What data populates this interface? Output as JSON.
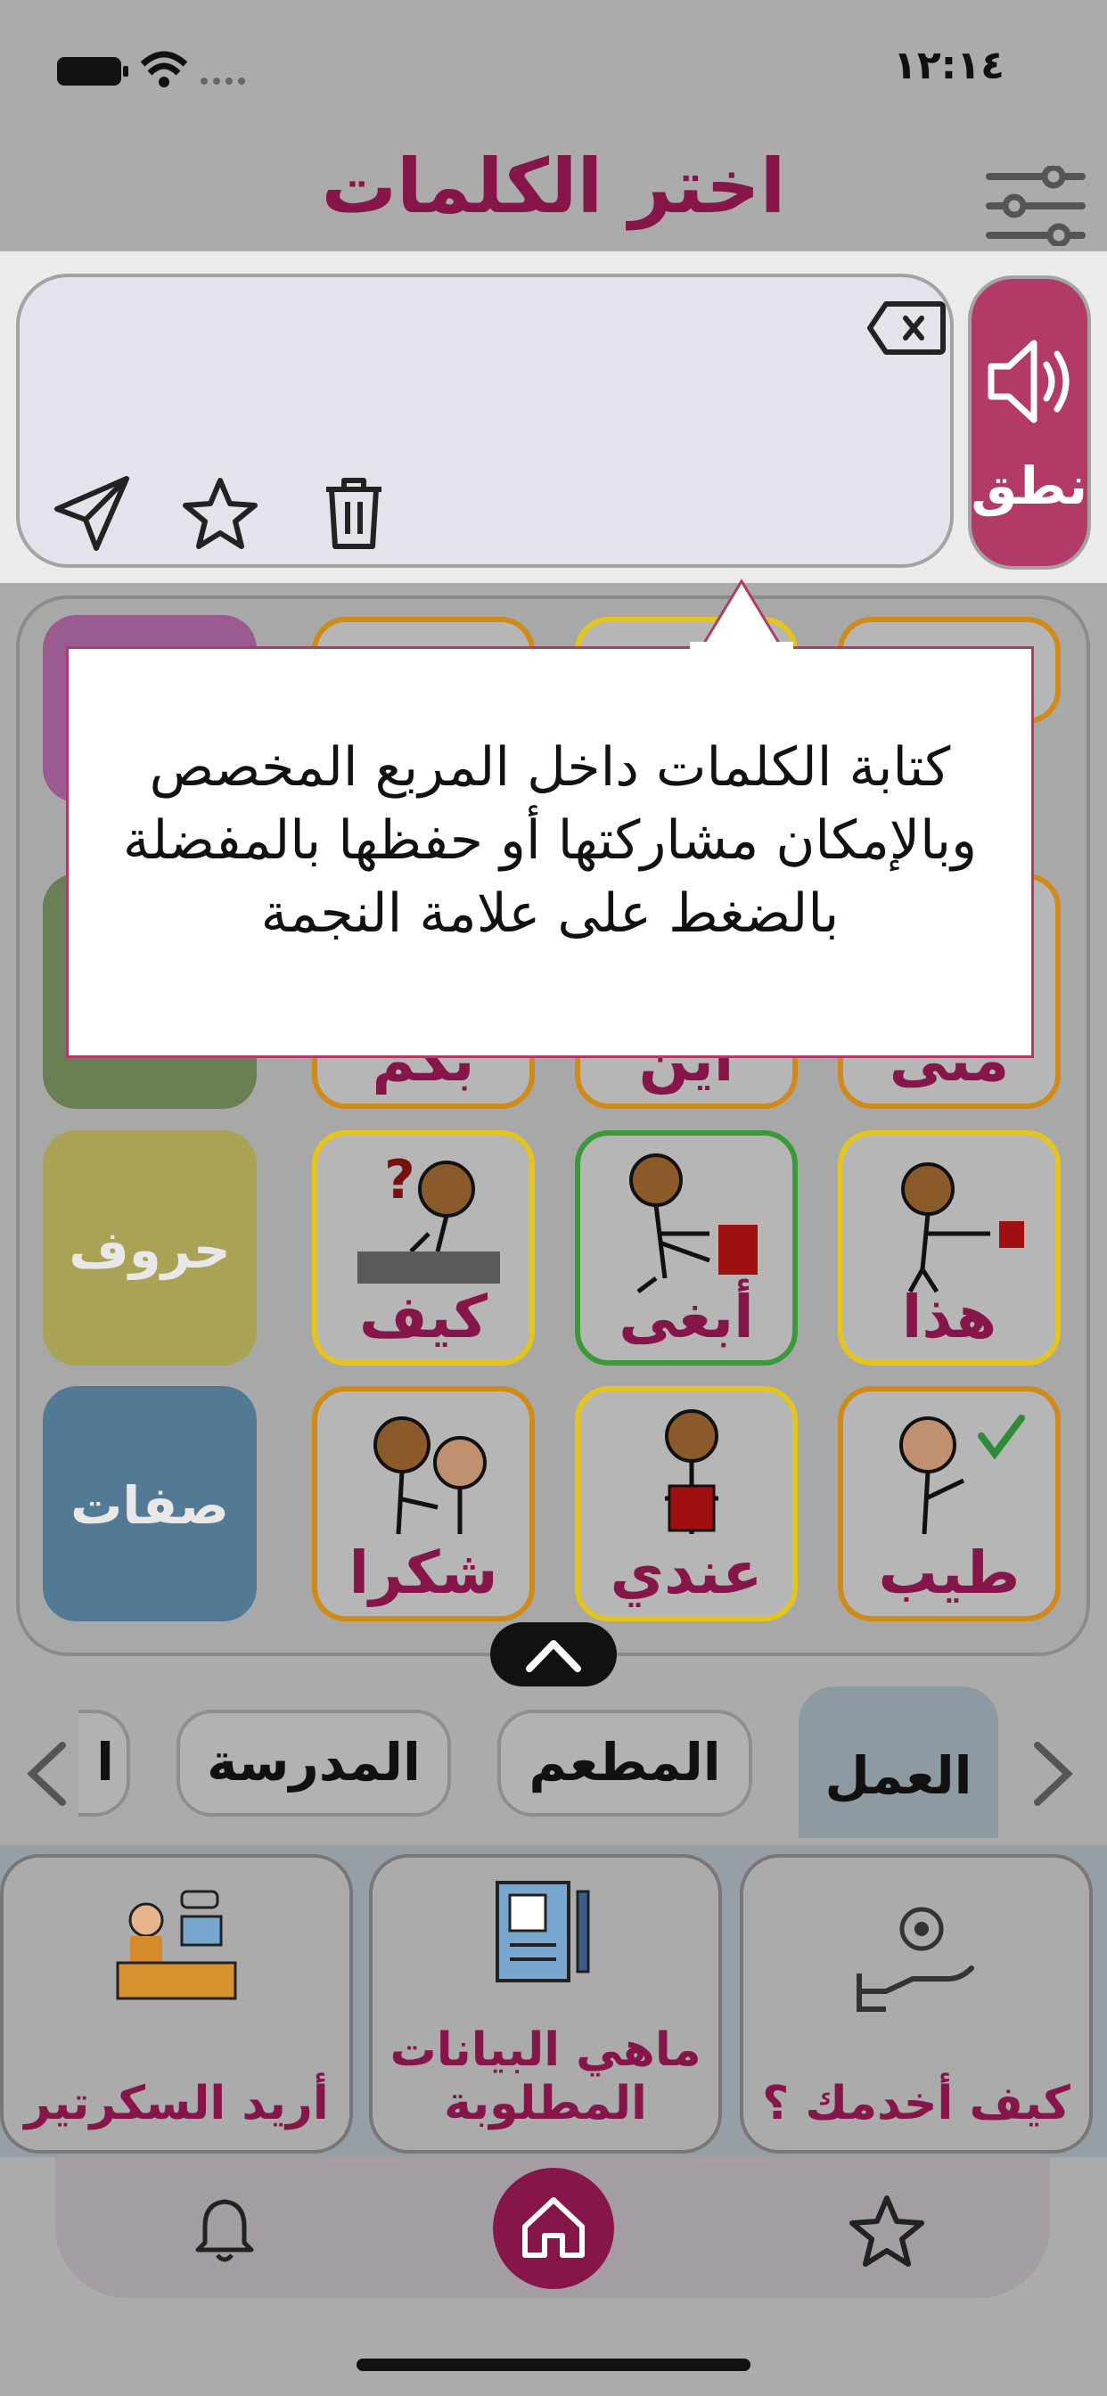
{
  "status_bar": {
    "time": "١٢:١٤"
  },
  "header": {
    "title": "اختر الكلمات"
  },
  "compose": {
    "speak_label": "نطق"
  },
  "tooltip": {
    "line1": "كتابة الكلمات داخل المربع المخصص",
    "line2": "وبالإمكان مشاركتها أو حفظها بالمفضلة",
    "line3": "بالضغط على علامة النجمة"
  },
  "grid": {
    "partial_row": [
      "بكم",
      "أين",
      "متى"
    ],
    "row3": [
      "كيف",
      "أبغى",
      "هذا"
    ],
    "row4": [
      "شكرا",
      "عندي",
      "طيب"
    ],
    "categories": {
      "letters": "حروف",
      "adjectives": "صفات"
    }
  },
  "tabs": {
    "work": "العمل",
    "restaurant": "المطعم",
    "school": "المدرسة",
    "partial": "ا"
  },
  "phrases": {
    "how_serve": "كيف أخدمك ؟",
    "data_required_1": "ماهي البيانات",
    "data_required_2": "المطلوبة",
    "secretary": "أريد السكرتير"
  },
  "colors": {
    "brand": "#86164a",
    "speak_button": "#b23a68",
    "orange_border": "#d08a1a",
    "yellow_border": "#e4c51e",
    "green_border": "#3a9a3a"
  }
}
